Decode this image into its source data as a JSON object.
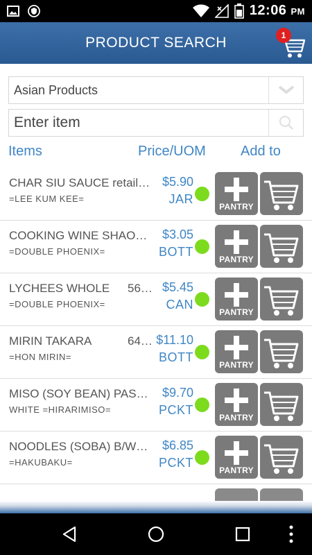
{
  "status_bar": {
    "time": "12:06",
    "ampm": "PM",
    "icons": [
      "image-icon",
      "shield-icon",
      "wifi-icon",
      "no-sim-icon",
      "battery-icon"
    ]
  },
  "header": {
    "title": "PRODUCT SEARCH",
    "cart_count": "1"
  },
  "filter": {
    "category_value": "Asian Products"
  },
  "search": {
    "placeholder": "Enter item"
  },
  "columns": {
    "items": "Items",
    "price": "Price/UOM",
    "add": "Add to"
  },
  "products": [
    {
      "name": "CHAR SIU SAUCE retail…",
      "size": "",
      "brand": "=LEE KUM KEE=",
      "price": "$5.90",
      "uom": "JAR"
    },
    {
      "name": "COOKING WINE SHAOH…",
      "size": "",
      "brand": "=DOUBLE PHOENIX=",
      "price": "$3.05",
      "uom": "BOTT"
    },
    {
      "name": "LYCHEES WHOLE",
      "size": "56…",
      "brand": "=DOUBLE PHOENIX=",
      "price": "$5.45",
      "uom": "CAN"
    },
    {
      "name": "MIRIN TAKARA",
      "size": "64…",
      "brand": "=HON MIRIN=",
      "price": "$11.10",
      "uom": "BOTT"
    },
    {
      "name": "MISO (SOY BEAN) PAST…",
      "size": "",
      "brand": "WHITE =HIRARIMISO=",
      "price": "$9.70",
      "uom": "PCKT"
    },
    {
      "name": "NOODLES (SOBA) B/WH…",
      "size": "",
      "brand": "=HAKUBAKU=",
      "price": "$6.85",
      "uom": "PCKT"
    }
  ],
  "buttons": {
    "pantry_label": "PANTRY"
  },
  "colors": {
    "header": "#2f5f97",
    "accent_text": "#3f86c6",
    "button_gray": "#7a7a7a",
    "in_stock_dot": "#7ddb1e",
    "badge": "#e02020"
  }
}
